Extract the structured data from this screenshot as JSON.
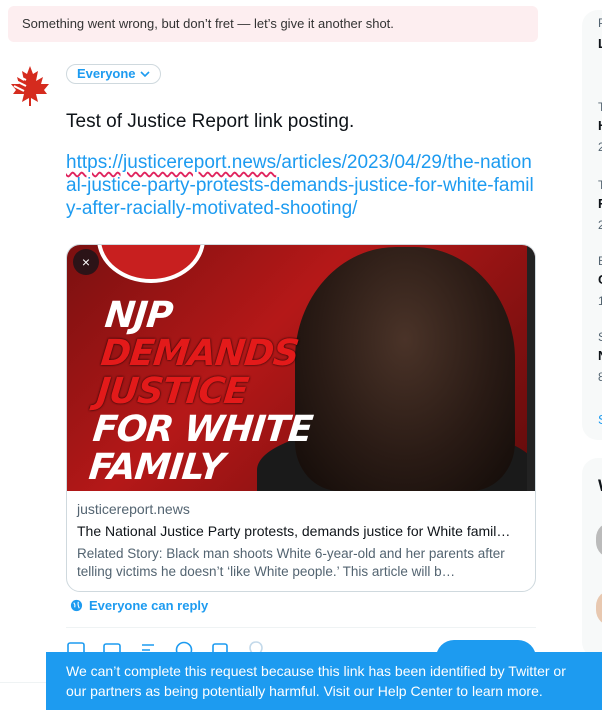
{
  "error_banner": {
    "text": "Something went wrong, but don’t fret — let’s give it another shot."
  },
  "composer": {
    "audience_label": "Everyone",
    "text_line1": "Test of Justice Report link posting.",
    "link_host": "https://justicereport.news",
    "link_path": "/articles/2023/04/29/the-national-justice-party-protests-demands-justice-for-white-family-after-racially-motivated-shooting/",
    "card": {
      "image_headline": [
        "NJP",
        "DEMANDS",
        "JUSTICE",
        "FOR WHITE",
        "FAMILY"
      ],
      "domain": "justicereport.news",
      "title": "The National Justice Party protests, demands justice for White famil…",
      "description": "Related Story: Black man shoots White 6-year-old and her parents after telling victims he doesn’t ‘like White people.’   This article will b…",
      "close_glyph": "×"
    },
    "reply_setting": "Everyone can reply"
  },
  "toast": {
    "text": "We can’t complete this request because this link has been identified by Twitter or our partners as being potentially harmful. Visit our Help Center to learn more."
  },
  "sidebar": {
    "letters": [
      "P",
      "L",
      "T",
      "H",
      "2",
      "T",
      "F",
      "2",
      "E",
      "C",
      "1",
      "S",
      "N",
      "8",
      "S",
      "W"
    ]
  },
  "colors": {
    "accent": "#1d9bf0",
    "error_bg": "#fdeef0",
    "image_red": "#b51818"
  },
  "icons": [
    "canada-maple-leaf-logo",
    "chevron-down-icon",
    "close-icon",
    "globe-icon",
    "image-icon",
    "gif-icon",
    "poll-icon",
    "emoji-icon",
    "schedule-icon",
    "location-icon"
  ]
}
